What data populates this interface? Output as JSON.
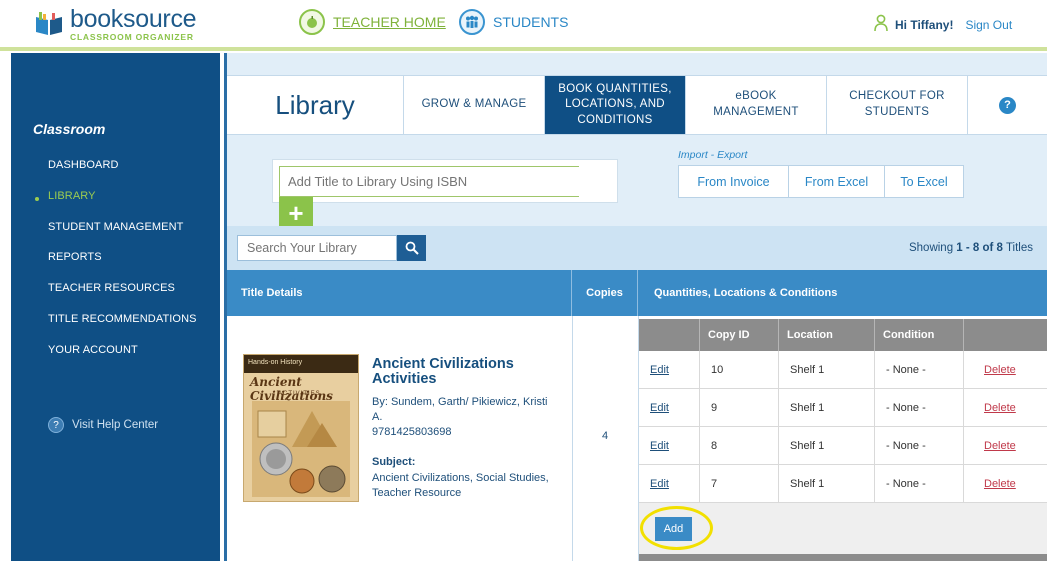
{
  "header": {
    "logo_main": "booksource",
    "logo_sub": "CLASSROOM ORGANIZER",
    "teacher_home": "TEACHER HOME",
    "students": "STUDENTS",
    "greeting": "Hi Tiffany!",
    "sign_out": "Sign Out"
  },
  "sidebar": {
    "title": "Classroom",
    "items": [
      {
        "label": "DASHBOARD"
      },
      {
        "label": "LIBRARY",
        "active": true
      },
      {
        "label": "STUDENT MANAGEMENT"
      },
      {
        "label": "REPORTS"
      },
      {
        "label": "TEACHER RESOURCES"
      },
      {
        "label": "TITLE RECOMMENDATIONS"
      },
      {
        "label": "YOUR ACCOUNT"
      }
    ],
    "help": "Visit Help Center"
  },
  "tabs": {
    "title": "Library",
    "items": [
      {
        "label": "GROW & MANAGE"
      },
      {
        "label": "BOOK QUANTITIES, LOCATIONS, AND CONDITIONS",
        "active": true
      },
      {
        "label": "eBOOK MANAGEMENT"
      },
      {
        "label": "CHECKOUT FOR STUDENTS"
      }
    ]
  },
  "isbn": {
    "placeholder": "Add Title to Library Using ISBN"
  },
  "import_export": {
    "label": "Import - Export",
    "buttons": [
      "From Invoice",
      "From Excel",
      "To Excel"
    ]
  },
  "search": {
    "placeholder": "Search Your Library",
    "showing_prefix": "Showing ",
    "showing_range": "1 - 8 of 8",
    "showing_suffix": " Titles"
  },
  "table": {
    "headers": [
      "Title Details",
      "Copies",
      "Quantities, Locations & Conditions"
    ],
    "inner_headers": [
      "",
      "Copy ID",
      "Location",
      "Condition",
      ""
    ]
  },
  "book": {
    "cover_band": "Hands-on History",
    "cover_title": "Ancient Civilizations",
    "cover_sub": "ACTIVITIES",
    "title": "Ancient Civilizations Activities",
    "by": "By: Sundem, Garth/ Pikiewicz, Kristi A.",
    "isbn": "9781425803698",
    "subject_label": "Subject:",
    "subject": "Ancient Civilizations, Social Studies, Teacher Resource",
    "copies": "4",
    "rows": [
      {
        "edit": "Edit",
        "copy_id": "10",
        "location": "Shelf 1",
        "condition": "- None -",
        "delete": "Delete"
      },
      {
        "edit": "Edit",
        "copy_id": "9",
        "location": "Shelf 1",
        "condition": "- None -",
        "delete": "Delete"
      },
      {
        "edit": "Edit",
        "copy_id": "8",
        "location": "Shelf 1",
        "condition": "- None -",
        "delete": "Delete"
      },
      {
        "edit": "Edit",
        "copy_id": "7",
        "location": "Shelf 1",
        "condition": "- None -",
        "delete": "Delete"
      }
    ],
    "add_label": "Add"
  },
  "colors": {
    "brand_blue": "#0f4f85",
    "accent_green": "#8bc34a",
    "header_blue": "#3a8bc6",
    "delete_red": "#c0394a",
    "highlight_yellow": "#f2e000"
  }
}
